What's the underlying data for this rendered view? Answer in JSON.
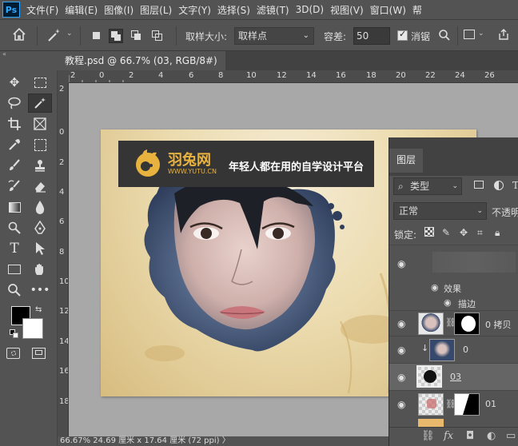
{
  "app": {
    "logo_text": "Ps"
  },
  "menu": [
    "文件(F)",
    "编辑(E)",
    "图像(I)",
    "图层(L)",
    "文字(Y)",
    "选择(S)",
    "滤镜(T)",
    "3D(D)",
    "视图(V)",
    "窗口(W)",
    "帮"
  ],
  "options": {
    "sample_size_label": "取样大小:",
    "sample_size_value": "取样点",
    "tolerance_label": "容差:",
    "tolerance_value": "50",
    "antialias_label": "消锯"
  },
  "document": {
    "tab_title": "教程.psd @ 66.7% (03, RGB/8#) *",
    "close_glyph": "×",
    "banner_brand": "羽兔网",
    "banner_url": "WWW.YUTU.CN",
    "banner_slogan": "年轻人都在用的自学设计平台"
  },
  "ruler_h": [
    "2",
    "0",
    "2",
    "4",
    "6",
    "8",
    "10",
    "12",
    "14",
    "16",
    "18",
    "20",
    "22",
    "24",
    "26"
  ],
  "ruler_v": [
    "2",
    "0",
    "2",
    "4",
    "6",
    "8",
    "10",
    "12",
    "14",
    "16",
    "18"
  ],
  "status": {
    "text": "66.67%   24.69 厘米 x 17.64 厘米 (72 ppi)   〉"
  },
  "layers_panel": {
    "tab_label": "图层",
    "filter_label": "类型",
    "blend_mode": "正常",
    "opacity_label": "不透明",
    "lock_label": "锁定:",
    "layers": [
      {
        "name": "",
        "kind": "blurred-top"
      },
      {
        "name": "效果",
        "kind": "effects"
      },
      {
        "name": "描边",
        "kind": "effect-item"
      },
      {
        "name": "0 拷贝",
        "kind": "layer-mask"
      },
      {
        "name": "0",
        "kind": "clipped"
      },
      {
        "name": "03",
        "kind": "selected"
      },
      {
        "name": "01",
        "kind": "layer-mask"
      }
    ]
  },
  "colors": {
    "ui_bg": "#535353",
    "panel_dark": "#424242",
    "brand_yellow": "#e8b23e",
    "selected_row": "#656565"
  },
  "icons": [
    "home-icon",
    "magic-wand-icon",
    "move-icon",
    "marquee-icon",
    "lasso-icon",
    "crop-icon",
    "eyedropper-icon",
    "brush-icon",
    "stamp-icon",
    "eraser-icon",
    "gradient-icon",
    "pen-icon",
    "text-icon",
    "path-select-icon",
    "rectangle-icon",
    "hand-icon",
    "zoom-icon",
    "more-icon",
    "eye-icon",
    "link-icon"
  ]
}
